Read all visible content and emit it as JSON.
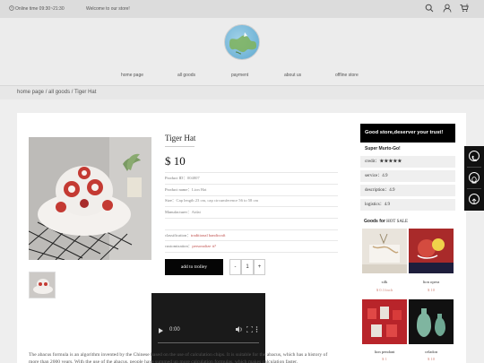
{
  "topbar": {
    "online_time": "Online time 09:30~21:30",
    "welcome": "Welcome to our store!",
    "icons": [
      "search-icon",
      "user-icon",
      "cart-icon"
    ],
    "cart_count": "0"
  },
  "nav": [
    "home page",
    "all goods",
    "payment",
    "about us",
    "offline store"
  ],
  "breadcrumb": [
    "home page",
    "all goods",
    "Tiger Hat"
  ],
  "product": {
    "title": "Tiger Hat",
    "price": "$ 10",
    "id_label": "Product ID",
    "id_value": "004807",
    "name_label": "Product name",
    "name_value": "Lion Hat",
    "size_label": "Size",
    "size_value": "Cap length 23 cm, cap circumference 56 to 58 cm",
    "mfr_label": "Manufacturer",
    "mfr_value": "Aidai",
    "classification_label": "classification",
    "classification_value": "traditional handicraft",
    "customization_label": "customization",
    "customization_value": "personalize it?",
    "add_to_trolley": "add to trolley",
    "qty_minus": "-",
    "qty_value": "1",
    "qty_plus": "+"
  },
  "video": {
    "time": "0:00"
  },
  "description": "The abacus formula is an algorithm invented by the Chinese based on the use of calculation chips. It is suitable for the abacus, which has a history of more than 2000 years. With the use of the abacus, people have summed up more calculation formulas, which makes calculation faster.",
  "sidebar": {
    "trust": "Good store,deserver your trust!",
    "seller": "Super Murto-Go!",
    "credit_label": "credit",
    "credit_stars": "★★★★★",
    "service_label": "service",
    "service_value": "4.9",
    "description_label": "description",
    "description_value": "4.9",
    "logistics_label": "logistics",
    "logistics_value": "4.9",
    "hot_sale_label": "Goods for",
    "hot_sale_title": "HOT SALE",
    "products": [
      {
        "name": "silk",
        "price": "$ 0.1/inch"
      },
      {
        "name": "lion opera",
        "price": "$ 10"
      },
      {
        "name": "lion pendant",
        "price": "$ 1"
      },
      {
        "name": "celadon",
        "price": "$ 10"
      }
    ]
  },
  "side_icons": [
    "phone-icon",
    "qq-icon",
    "back-to-top-icon"
  ],
  "colors": {
    "accent": "#000000",
    "highlight": "#c0504d"
  }
}
